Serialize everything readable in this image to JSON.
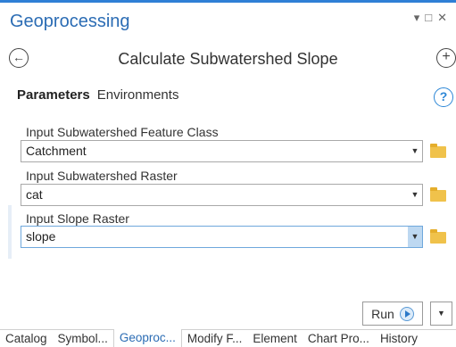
{
  "pane": {
    "title": "Geoprocessing",
    "controls": {
      "pin": "▾",
      "maximize": "□",
      "close": "✕"
    }
  },
  "tool": {
    "title": "Calculate Subwatershed Slope",
    "back_glyph": "←",
    "add_glyph": "+"
  },
  "tabs": [
    {
      "label": "Parameters"
    },
    {
      "label": "Environments"
    }
  ],
  "help_glyph": "?",
  "parameters": [
    {
      "label": "Input Subwatershed Feature Class",
      "value": "Catchment"
    },
    {
      "label": "Input Subwatershed Raster",
      "value": "cat"
    },
    {
      "label": "Input Slope Raster",
      "value": "slope"
    }
  ],
  "caret_glyph": "▼",
  "run": {
    "label": "Run",
    "menu_glyph": "▼"
  },
  "bottom_tabs": [
    {
      "label": "Catalog"
    },
    {
      "label": "Symbol..."
    },
    {
      "label": "Geoproc..."
    },
    {
      "label": "Modify F..."
    },
    {
      "label": "Element"
    },
    {
      "label": "Chart Pro..."
    },
    {
      "label": "History"
    }
  ]
}
